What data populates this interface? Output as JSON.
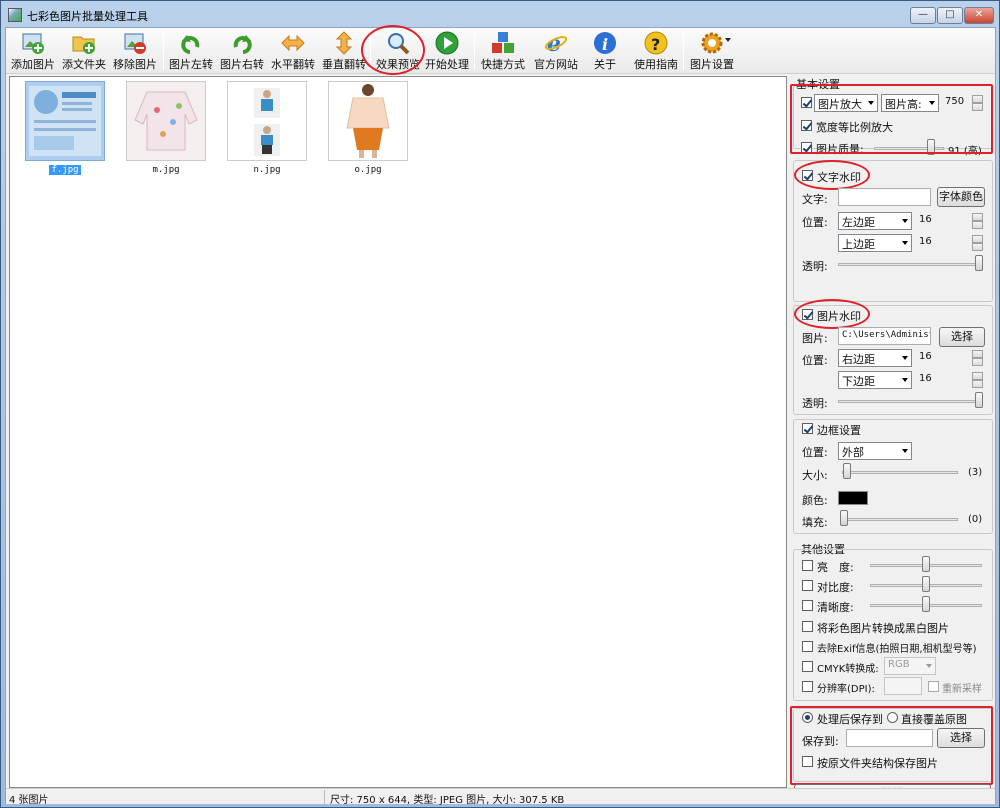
{
  "window": {
    "title": "七彩色图片批量处理工具",
    "min_btn": "—",
    "max_btn": "□",
    "close_btn": "✕"
  },
  "toolbar": [
    {
      "label": "添加图片",
      "icon": "add-image-icon"
    },
    {
      "label": "添文件夹",
      "icon": "add-folder-icon"
    },
    {
      "label": "移除图片",
      "icon": "remove-image-icon"
    },
    {
      "label": "图片左转",
      "icon": "rotate-left-icon"
    },
    {
      "label": "图片右转",
      "icon": "rotate-right-icon"
    },
    {
      "label": "水平翻转",
      "icon": "flip-horizontal-icon"
    },
    {
      "label": "垂直翻转",
      "icon": "flip-vertical-icon"
    },
    {
      "label": "效果预览",
      "icon": "preview-magnifier-icon"
    },
    {
      "label": "开始处理",
      "icon": "play-icon"
    },
    {
      "label": "快捷方式",
      "icon": "shortcut-cubes-icon"
    },
    {
      "label": "官方网站",
      "icon": "ie-browser-icon"
    },
    {
      "label": "关于",
      "icon": "info-icon"
    },
    {
      "label": "使用指南",
      "icon": "help-icon"
    },
    {
      "label": "图片设置",
      "icon": "gear-icon"
    }
  ],
  "images": [
    {
      "name": "f.jpg",
      "selected": true
    },
    {
      "name": "m.jpg",
      "selected": false
    },
    {
      "name": "n.jpg",
      "selected": false
    },
    {
      "name": "o.jpg",
      "selected": false
    }
  ],
  "basic": {
    "title": "基本设置",
    "enlarge_checked": true,
    "enlarge_mode": "图片放大",
    "dimension": "图片高:",
    "size_value": "750",
    "proportional_label": "宽度等比例放大",
    "proportional_checked": true,
    "quality_label": "图片质量:",
    "quality_checked": true,
    "quality_value": "91",
    "quality_level": "(高)"
  },
  "text_watermark": {
    "title": "文字水印",
    "checked": true,
    "text_label": "文字:",
    "text_value": "",
    "font_color_btn": "字体颜色",
    "position_label": "位置:",
    "h_anchor": "左边距",
    "h_value": "16",
    "v_anchor": "上边距",
    "v_value": "16",
    "opacity_label": "透明:"
  },
  "image_watermark": {
    "title": "图片水印",
    "checked": true,
    "image_label": "图片:",
    "image_path": "C:\\Users\\Administr",
    "choose_btn": "选择",
    "position_label": "位置:",
    "h_anchor": "右边距",
    "h_value": "16",
    "v_anchor": "下边距",
    "v_value": "16",
    "opacity_label": "透明:"
  },
  "border": {
    "title": "边框设置",
    "checked": true,
    "position_label": "位置:",
    "position_value": "外部",
    "size_label": "大小:",
    "size_value": "(3)",
    "color_label": "颜色:",
    "color": "#000000",
    "fill_label": "填充:",
    "fill_value": "(0)"
  },
  "other": {
    "title": "其他设置",
    "brightness_label": "亮　度:",
    "contrast_label": "对比度:",
    "sharpness_label": "清晰度:",
    "grayscale_label": "将彩色图片转换成黑白图片",
    "exif_label": "去除Exif信息(拍照日期,相机型号等)",
    "cmyk_label": "CMYK转换成:",
    "cmyk_value": "RGB",
    "dpi_label": "分辨率(DPI):",
    "dpi_value": "",
    "resample_label": "重新采样"
  },
  "output": {
    "save_after_label": "处理后保存到",
    "save_after_selected": true,
    "overwrite_label": "直接覆盖原图",
    "save_to_label": "保存到:",
    "save_to_value": "",
    "choose_btn": "选择",
    "keep_structure_label": "按原文件夹结构保存图片",
    "start_btn": "开始处理"
  },
  "status": {
    "count": "4 张图片",
    "info": "尺寸: 750 x 644, 类型: JPEG 图片, 大小: 307.5 KB"
  }
}
